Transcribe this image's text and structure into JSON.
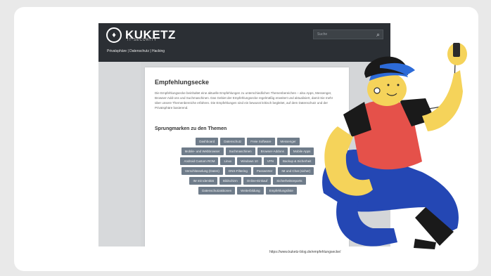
{
  "site": {
    "logo_text": "KUKETZ",
    "logo_sub": "IT-SECURITY",
    "tagline": "Privatsphäre | Datenschutz | Hacking",
    "search_placeholder": "Suche"
  },
  "article": {
    "title": "Empfehlungsecke",
    "intro": "Die Empfehlungsecke beinhaltet eine aktuelle Empfehlungen zu unterschiedlichen Themenbereichen – also Apps, Messenger, Browser-Add-ons und Suchmaschinen. Das Gebiet der Empfehlungsecke regelmäßig erweitert und aktualisiert, damit Sie mehr über unsere Themenbereiche erfahren. Die Empfehlungen sind ein bewusst kritisch begleitet, auf dem Datenschutz und der Privatsphäre basierend.",
    "jump_heading": "Sprungmarken zu den Themen",
    "tags": [
      "Dashboard",
      "Datenschutz",
      "Freie Software",
      "Messenger",
      "Mobile- und Webbrowser",
      "Suchmaschinen",
      "Browser-Addons",
      "Mobile Apps",
      "Android Custom ROM",
      "Linux",
      "Windows 10",
      "VPN",
      "Backup & Sicherheit",
      "Verschlüsselung (Daten)",
      "DNS-Filtering",
      "Passwörter",
      "IM und Chat (sicher)",
      "IM mit Identität",
      "Bildschirm",
      "Online-Einkauf",
      "Sicherheitsreports",
      "Datenschutzaktionen",
      "Weiterbildung",
      "Empfehlungsliste"
    ]
  },
  "caption": "https://www.kuketz-blog.de/empfehlungsecke/",
  "colors": {
    "header_bg": "#2b2f34",
    "tag_bg": "#6f7c8a",
    "cap_brim": "#2d6bd8",
    "shirt": "#e5514a",
    "pants": "#2447b4",
    "skin": "#f5d35a"
  },
  "illustration": {
    "icon_names": [
      "person-listening-icon"
    ]
  }
}
